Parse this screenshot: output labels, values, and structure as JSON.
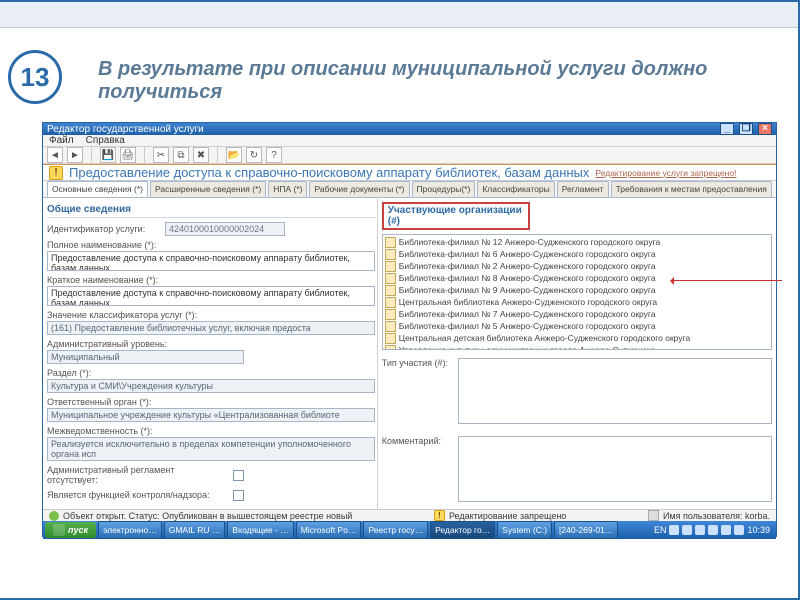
{
  "slide": {
    "number": "13",
    "title": "В результате при описании муниципальной услуги должно получиться"
  },
  "window": {
    "title": "Редактор государственной услуги",
    "menu": {
      "file": "Файл",
      "help": "Справка"
    },
    "doc_title": "Предоставление доступа к справочно-поисковому аппарату библиотек, базам данных",
    "doc_subtitle": "Редактирование услуги запрещено!",
    "tabs": [
      "Основные сведения (*)",
      "Расширенные сведения (*)",
      "НПА (*)",
      "Рабочие документы (*)",
      "Процедуры(*)",
      "Классификаторы",
      "Регламент",
      "Требования к местам предоставления"
    ]
  },
  "left": {
    "section_title": "Общие сведения",
    "id_label": "Идентификатор услуги:",
    "id_value": "4240100010000002024",
    "fullname_label": "Полное наименование (*):",
    "fullname_value": "Предоставление доступа к справочно-поисковому аппарату библиотек, базам данных",
    "shortname_label": "Краткое наименование (*):",
    "shortname_value": "Предоставление доступа к справочно-поисковому аппарату библиотек, базам данных",
    "classifier_label": "Значение классификатора услуг (*):",
    "classifier_value": "(161) Предоставление библиотечных услуг, включая предоста",
    "admin_level_label": "Административный уровень:",
    "admin_level_value": "Муниципальный",
    "section_label": "Раздел (*):",
    "section_value": "Культура и СМИ\\Учреждения культуры",
    "resp_label": "Ответственный орган (*):",
    "resp_value": "Муниципальное учреждение культуры «Централизованная библиоте",
    "inter_label": "Межведомственность (*):",
    "inter_value": "Реализуется исключительно в пределах компетенции уполномоченного органа исп",
    "reg_missing_label": "Административный регламент отсутствует:",
    "control_label": "Является функцией контроля/надзора:"
  },
  "right": {
    "header": "Участвующие организации (#)",
    "orgs": [
      "Библиотека-филиал № 12 Анжеро-Судженского городского округа",
      "Библиотека-филиал № 6 Анжеро-Судженского городского округа",
      "Библиотека-филиал № 2 Анжеро-Судженского городского округа",
      "Библиотека-филиал № 8 Анжеро-Судженского городского округа",
      "Библиотека-филиал № 9 Анжеро-Судженского городского округа",
      "Центральная библиотека Анжеро-Судженского городского округа",
      "Библиотека-филиал № 7 Анжеро-Судженского городского округа",
      "Библиотека-филиал № 5 Анжеро-Судженского городского округа",
      "Центральная детская библиотека Анжеро-Судженского городского округа",
      "Управление культуры администрации города Анжеро-Судженска"
    ],
    "type_label": "Тип участия (#):",
    "comment_label": "Комментарий:"
  },
  "status": {
    "left": "Объект открыт. Статус: Опубликован в вышестоящем реестре новый",
    "mid": "Редактирование запрещено",
    "right": "Имя пользователя: korba."
  },
  "taskbar": {
    "start": "пуск",
    "items": [
      "электронно…",
      "GMAIL RU …",
      "Входящие - …",
      "Microsoft Po…",
      "Реестр госу…",
      "Редактор го…",
      "System (C:)",
      "[240-269-01…"
    ],
    "lang": "EN",
    "clock": "10:39"
  }
}
